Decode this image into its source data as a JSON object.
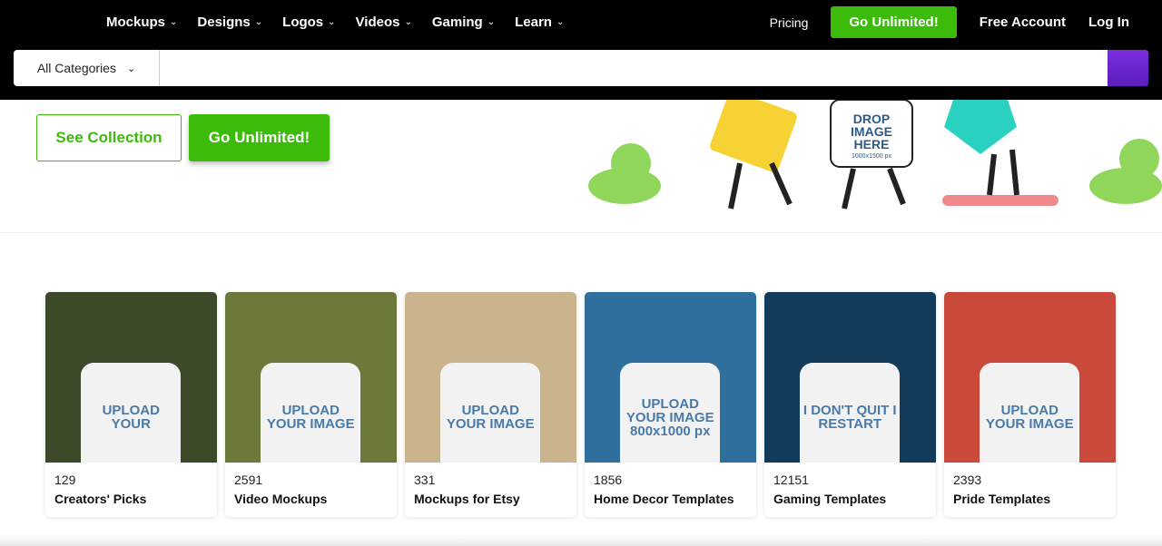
{
  "nav": {
    "items": [
      {
        "label": "Mockups"
      },
      {
        "label": "Designs"
      },
      {
        "label": "Logos"
      },
      {
        "label": "Videos"
      },
      {
        "label": "Gaming"
      },
      {
        "label": "Learn"
      }
    ],
    "pricing": "Pricing",
    "go_unlimited": "Go Unlimited!",
    "free_account": "Free Account",
    "log_in": "Log In"
  },
  "search": {
    "category": "All Categories",
    "value": "",
    "placeholder": ""
  },
  "hero": {
    "see_collection": "See Collection",
    "go_unlimited": "Go Unlimited!",
    "illustration_text": "DROP IMAGE HERE",
    "illustration_sub": "1000x1500 px"
  },
  "colors": {
    "accent": "#3dbb0a",
    "search_button": "#6a24d0"
  },
  "cards": [
    {
      "count": "129",
      "title": "Creators' Picks",
      "shirt": "UPLOAD YOUR",
      "bg": "#3c4a2a"
    },
    {
      "count": "2591",
      "title": "Video Mockups",
      "shirt": "UPLOAD YOUR IMAGE",
      "bg": "#6b7a3a"
    },
    {
      "count": "331",
      "title": "Mockups for Etsy",
      "shirt": "UPLOAD YOUR IMAGE",
      "bg": "#c9b48e"
    },
    {
      "count": "1856",
      "title": "Home Decor Templates",
      "shirt": "UPLOAD YOUR IMAGE 800x1000 px",
      "bg": "#2f6f9e"
    },
    {
      "count": "12151",
      "title": "Gaming Templates",
      "shirt": "I DON'T QUIT I RESTART",
      "bg": "#123a5a"
    },
    {
      "count": "2393",
      "title": "Pride Templates",
      "shirt": "UPLOAD YOUR IMAGE",
      "bg": "#c94a3a"
    }
  ]
}
